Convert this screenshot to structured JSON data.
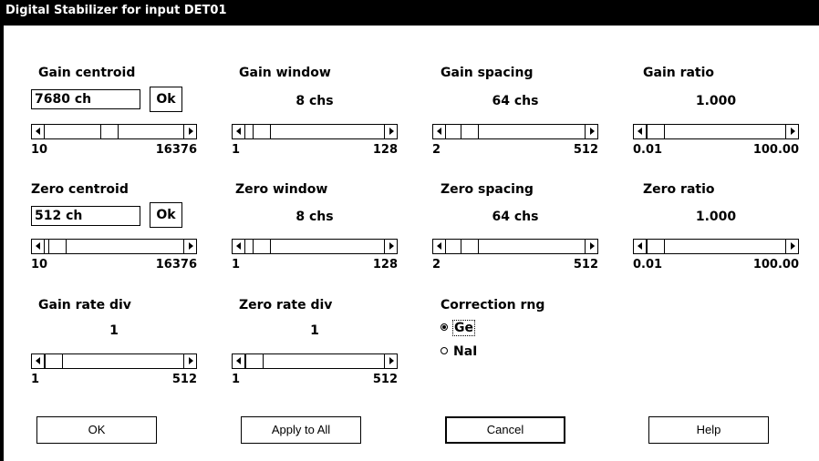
{
  "window": {
    "title": "Digital Stabilizer for input DET01"
  },
  "gain_centroid": {
    "label": "Gain centroid",
    "value": "7680 ch",
    "ok_label": "Ok",
    "min": "10",
    "max": "16376",
    "thumb_pct": 0.46
  },
  "gain_window": {
    "label": "Gain window",
    "value": "8 chs",
    "min": "1",
    "max": "128",
    "thumb_pct": 0.06
  },
  "gain_spacing": {
    "label": "Gain spacing",
    "value": "64 chs",
    "min": "2",
    "max": "512",
    "thumb_pct": 0.12
  },
  "gain_ratio": {
    "label": "Gain ratio",
    "value": "1.000",
    "min": "0.01",
    "max": "100.00",
    "thumb_pct": 0.0
  },
  "zero_centroid": {
    "label": "Zero centroid",
    "value": "512 ch",
    "ok_label": "Ok",
    "min": "10",
    "max": "16376",
    "thumb_pct": 0.03
  },
  "zero_window": {
    "label": "Zero window",
    "value": "8 chs",
    "min": "1",
    "max": "128",
    "thumb_pct": 0.06
  },
  "zero_spacing": {
    "label": "Zero spacing",
    "value": "64 chs",
    "min": "2",
    "max": "512",
    "thumb_pct": 0.12
  },
  "zero_ratio": {
    "label": "Zero ratio",
    "value": "1.000",
    "min": "0.01",
    "max": "100.00",
    "thumb_pct": 0.0
  },
  "gain_rate_div": {
    "label": "Gain rate div",
    "value": "1",
    "min": "1",
    "max": "512",
    "thumb_pct": 0.0
  },
  "zero_rate_div": {
    "label": "Zero rate div",
    "value": "1",
    "min": "1",
    "max": "512",
    "thumb_pct": 0.0
  },
  "correction_rng": {
    "label": "Correction rng",
    "options": [
      "Ge",
      "NaI"
    ],
    "selected": "Ge"
  },
  "buttons": {
    "ok": "OK",
    "apply_all": "Apply to All",
    "cancel": "Cancel",
    "help": "Help"
  }
}
